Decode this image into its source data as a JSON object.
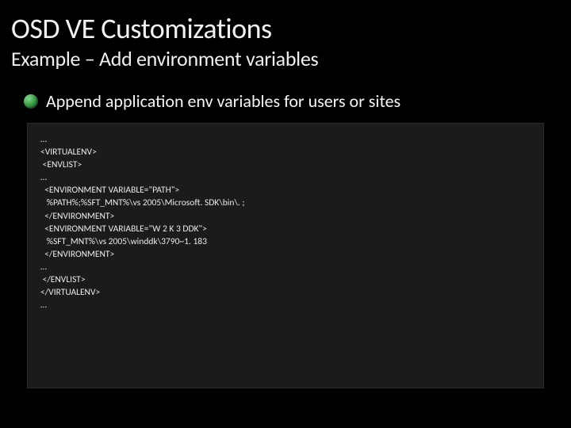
{
  "title": "OSD VE Customizations",
  "subtitle": "Example – Add environment variables",
  "bullet": {
    "text": "Append application env variables for users or sites",
    "icon_name": "green-sphere-bullet"
  },
  "code": "…\n<VIRTUALENV>\n <ENVLIST>\n…\n  <ENVIRONMENT VARIABLE=\"PATH\">\n   %PATH%;%SFT_MNT%\\vs 2005\\Microsoft. SDK\\bin\\. ;\n  </ENVIRONMENT>\n  <ENVIRONMENT VARIABLE=\"W 2 K 3 DDK\">\n   %SFT_MNT%\\vs 2005\\winddk\\3790~1. 183\n  </ENVIRONMENT>\n…\n </ENVLIST>\n</VIRTUALENV>\n…"
}
